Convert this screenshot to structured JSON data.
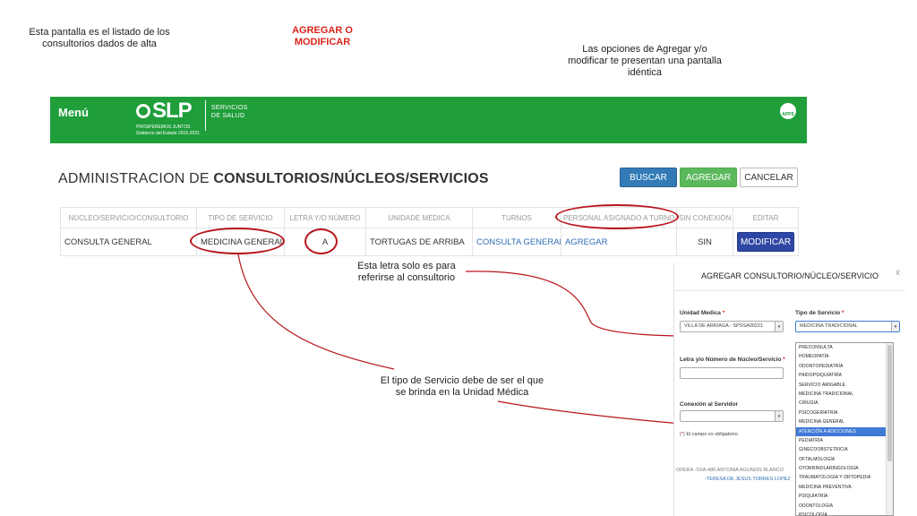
{
  "notes": {
    "listing": "Esta pantalla  es el listado de los consultorios dados de alta",
    "add_modify": "AGREGAR O MODIFICAR",
    "options": "Las opciones de Agregar y/o modificar te presentan una pantalla idéntica",
    "letter": "Esta letra solo es para referirse al consultorio",
    "service_type": "El tipo de Servicio debe de ser el que se brinda en la Unidad Médica"
  },
  "header": {
    "menu_label": "Menú",
    "logo_text": "SLP",
    "logo_subtitle": "PROSPEREMOS JUNTOS",
    "logo_subtitle2": "Gobierno del Estado 2015-2021",
    "logo_service": "SERVICIOS",
    "logo_service2": "DE SALUD",
    "apps_label": "APPS"
  },
  "page": {
    "title_prefix": "ADMINISTRACION DE ",
    "title_bold": "CONSULTORIOS/NÚCLEOS/SERVICIOS"
  },
  "toolbar": {
    "search_label": "BUSCAR",
    "add_label": "AGREGAR",
    "cancel_label": "CANCELAR"
  },
  "table": {
    "headers": [
      "NÚCLEO/SERVICIO/CONSULTORIO",
      "TIPO DE SERVICIO",
      "LETRA Y/O NÚMERO",
      "UNIDADE MEDICA",
      "TURNOS",
      "PERSONAL ASIGNADO A TURNO",
      "SIN CONEXIÓN",
      "EDITAR"
    ],
    "row": {
      "nucleo": "CONSULTA GENERAL",
      "tipo": "MEDICINA GENERAL",
      "letra": "A",
      "unidad": "TORTUGAS DE ARRIBA",
      "turnos": "CONSULTA GENERAL",
      "personal": "AGREGAR",
      "sin_conexion": "SIN",
      "edit_label": "MODIFICAR"
    }
  },
  "modal": {
    "title": "AGREGAR CONSULTORIO/NÚCLEO/SERVICIO",
    "close": "x",
    "unidad_label": "Unidad Medica",
    "unidad_value": "VILLA DE ARRIAGA - SPSSA00221",
    "tipo_label": "Tipo de Servicio",
    "tipo_value": "MEDICINA TRADICIONAL",
    "letra_label": "Letra y/o Número de Núcleo/Servicio",
    "conexion_label": "Conexión al Servidor",
    "required_mark": "*",
    "required_note": " El campo es obligatorio.",
    "bg_row_1": "OPERA     -SSA-486 ANTONIA AGUNDIS BLANCO",
    "bg_row_2": "-TERESA DE JESUS TORRES LOPEZ",
    "options": [
      "PRECONSULTA",
      "HOMEOPATÍA",
      "ODONTOPEDIATRÍA",
      "PAIDOPSIQUIATRÍA",
      "SERVICIO AMIGABLE",
      "MEDICINA TRADICIONAL",
      "CIRUGÍA",
      "PSICOGERIATRÍA",
      "MEDICINA GENERAL",
      "ATENCIÓN A ADICCIONES",
      "PEDIATRÍA",
      "GINECOOBSTETRICIA",
      "OFTALMOLOGÍA",
      "OTORRINOLARINGOLOGÍA",
      "TRAUMATOLOGÍA Y ORTOPEDIA",
      "MEDICINA PREVENTIVA",
      "PSIQUIATRÍA",
      "ODONTOLOGÍA",
      "PSICOLOGÍA"
    ],
    "highlighted_option": "ATENCIÓN A ADICCIONES"
  },
  "colors": {
    "header_green": "#1f9e3a",
    "annotation_red": "#b8141b",
    "primary_blue": "#337ab7",
    "success_green": "#5cb85c"
  }
}
